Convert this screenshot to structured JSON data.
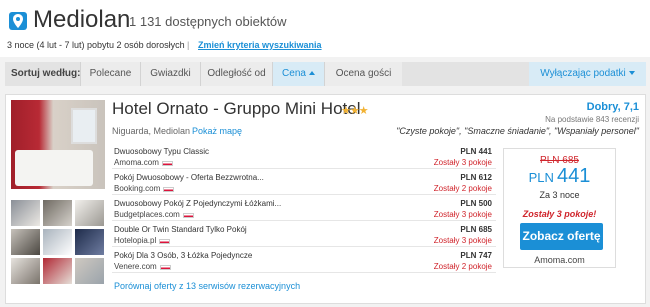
{
  "header": {
    "city": "Mediolan",
    "count": "1 131 dostępnych obiektów",
    "stay": "3 noce (4 lut - 7 lut) pobytu 2 osób dorosłych",
    "separator": "|",
    "change_link": "Zmień kryteria wyszukiwania"
  },
  "sortbar": {
    "label": "Sortuj według:",
    "tabs": [
      "Polecane",
      "Gwiazdki",
      "Odległość od",
      "Cena",
      "Ocena gości"
    ],
    "active": "Cena",
    "tax_button": "Wyłączając podatki"
  },
  "hotel": {
    "name": "Hotel Ornato - Gruppo Mini Hotel",
    "stars": "★★★",
    "location": "Niguarda, Mediolan",
    "map_link": "Pokaż mapę",
    "rating": "Dobry, 7,1",
    "reviews": "Na podstawie 843 recenzji",
    "quote": "\"Czyste pokoje\", \"Smaczne śniadanie\", \"Wspaniały personel\"",
    "offers": [
      {
        "name": "Dwuosobowy Typu Classic",
        "site": "Amoma.com",
        "price": "PLN 441",
        "left": "Zostały 3 pokoje"
      },
      {
        "name": "Pokój Dwuosobowy - Oferta Bezzwrotna...",
        "site": "Booking.com",
        "price": "PLN 612",
        "left": "Zostały 2 pokoje"
      },
      {
        "name": "Dwuosobowy Pokój Z Pojedynczymi Łóżkami...",
        "site": "Budgetplaces.com",
        "price": "PLN 500",
        "left": "Zostały 3 pokoje"
      },
      {
        "name": "Double Or Twin Standard Tylko Pokój",
        "site": "Hotelopia.pl",
        "price": "PLN 685",
        "left": "Zostały 3 pokoje"
      },
      {
        "name": "Pokój Dla 3 Osób, 3 Łóżka Pojedyncze",
        "site": "Venere.com",
        "price": "PLN 747",
        "left": "Zostały 2 pokoje"
      }
    ],
    "compare_link": "Porównaj oferty z 13 serwisów rezerwacyjnych",
    "price_box": {
      "old_price": "PLN 685",
      "currency": "PLN",
      "price": "441",
      "nights": "Za 3 noce",
      "rooms_left": "Zostały 3 pokoje!",
      "cta": "Zobacz ofertę",
      "site": "Amoma.com"
    }
  },
  "colors": {
    "accent": "#1b8fd6",
    "alert": "#d0252c",
    "stars": "#f2b233"
  }
}
